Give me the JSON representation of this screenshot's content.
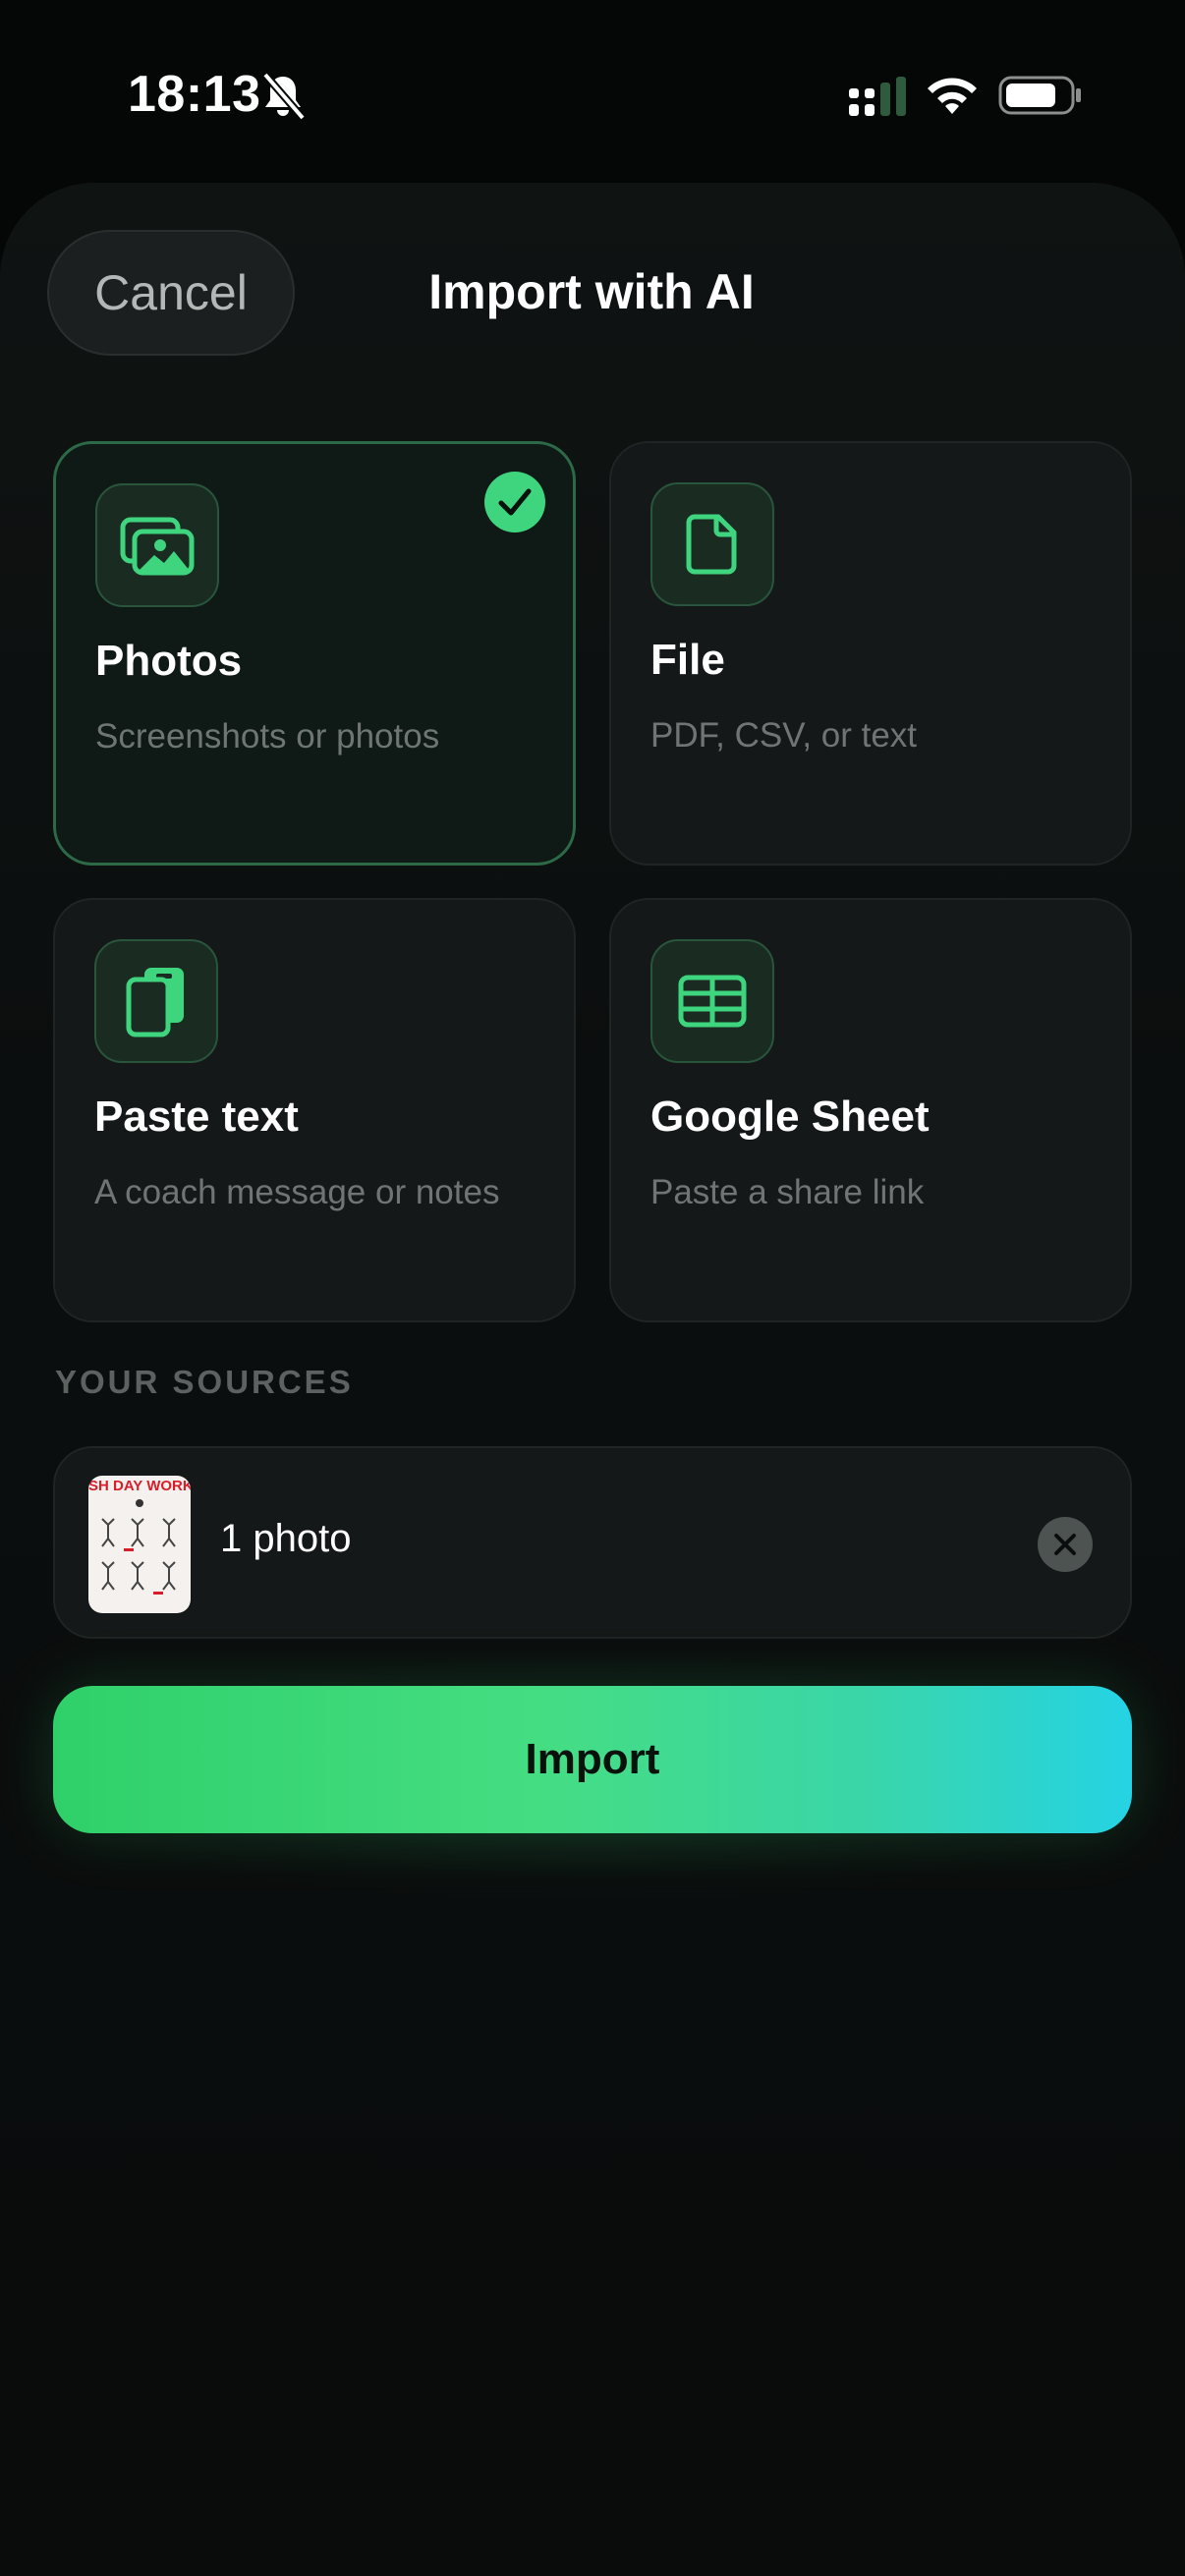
{
  "status_bar": {
    "time": "18:13",
    "icons": [
      "bell-slash-icon",
      "cellular-signal-icon",
      "wifi-icon",
      "battery-icon"
    ]
  },
  "sheet": {
    "cancel_label": "Cancel",
    "title": "Import with AI"
  },
  "options": [
    {
      "title": "Photos",
      "subtitle": "Screenshots or photos",
      "icon": "photos-icon",
      "selected": true
    },
    {
      "title": "File",
      "subtitle": "PDF, CSV, or text",
      "icon": "file-icon",
      "selected": false
    },
    {
      "title": "Paste text",
      "subtitle": "A coach message or notes",
      "icon": "paste-icon",
      "selected": false
    },
    {
      "title": "Google Sheet",
      "subtitle": "Paste a share link",
      "icon": "table-icon",
      "selected": false
    }
  ],
  "sources": {
    "section_label": "YOUR SOURCES",
    "items": [
      {
        "label": "1 photo",
        "thumbnail_text": "SH DAY WORKO"
      }
    ]
  },
  "import_label": "Import",
  "colors": {
    "accent": "#3fd57e",
    "gradient_start": "#2fd06a",
    "gradient_end": "#25d3e4",
    "background": "#0b0e0e"
  }
}
